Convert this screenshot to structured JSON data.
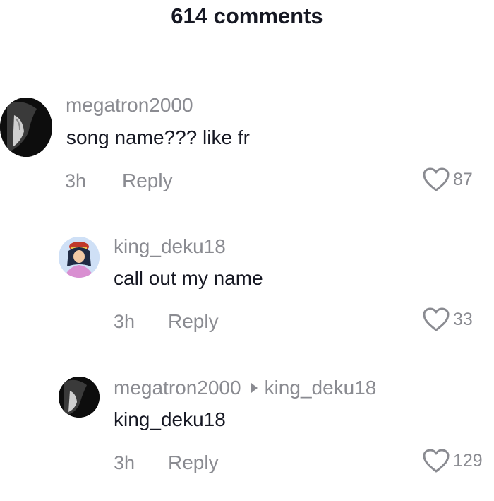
{
  "header": {
    "title": "614 comments"
  },
  "comments": [
    {
      "username": "megatron2000",
      "text": "song name??? like fr",
      "time": "3h",
      "reply_label": "Reply",
      "likes": "87"
    },
    {
      "username": "king_deku18",
      "text": "call out my name",
      "time": "3h",
      "reply_label": "Reply",
      "likes": "33"
    },
    {
      "username": "megatron2000",
      "reply_to": "king_deku18",
      "text": "king_deku18",
      "time": "3h",
      "reply_label": "Reply",
      "likes": "129"
    }
  ],
  "icons": {
    "like": "heart-outline-icon",
    "reply_arrow": "triangle-right-icon"
  },
  "colors": {
    "primary_text": "#161823",
    "secondary_text": "#8a8b91",
    "background": "#ffffff"
  }
}
